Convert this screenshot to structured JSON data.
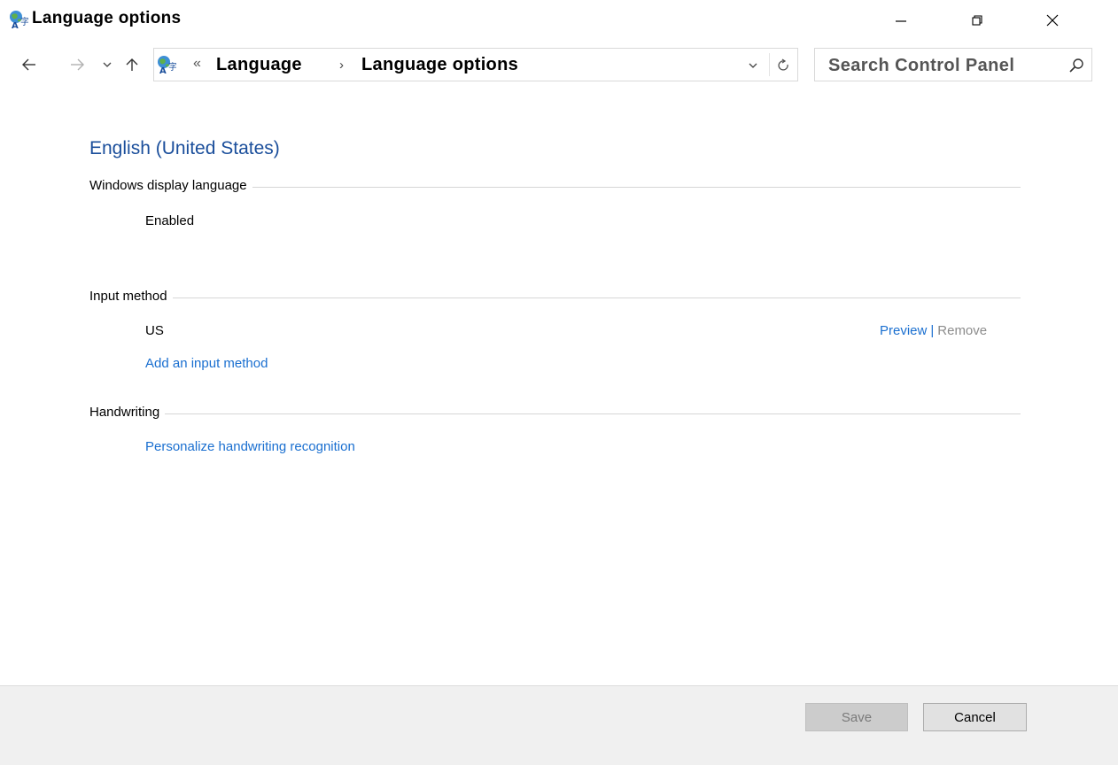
{
  "window": {
    "title": "Language options",
    "icon": "language-globe-icon",
    "controls": {
      "minimize": "minimize-icon",
      "maximize": "restore-icon",
      "close": "close-icon"
    }
  },
  "nav": {
    "icons": {
      "back": "back-arrow-icon",
      "forward": "forward-arrow-icon",
      "recent": "chevron-down-icon",
      "up": "up-arrow-icon"
    },
    "address": {
      "overflow": "«",
      "breadcrumbs": [
        "Language",
        "Language options"
      ],
      "separator": "›"
    },
    "search": {
      "placeholder": "Search Control Panel"
    }
  },
  "main": {
    "language_name": "English (United States)",
    "sections": {
      "display": {
        "label": "Windows display language",
        "status": "Enabled"
      },
      "input": {
        "label": "Input method",
        "method": "US",
        "preview": "Preview",
        "separator": "|",
        "remove": "Remove",
        "add_link": "Add an input method"
      },
      "handwriting": {
        "label": "Handwriting",
        "link": "Personalize handwriting recognition"
      }
    }
  },
  "footer": {
    "save": "Save",
    "cancel": "Cancel"
  },
  "colors": {
    "link": "#1a6fd0",
    "title_blue": "#1a4e9b",
    "disabled_text": "#8c8c8c",
    "footer_bg": "#f0f0f0"
  }
}
